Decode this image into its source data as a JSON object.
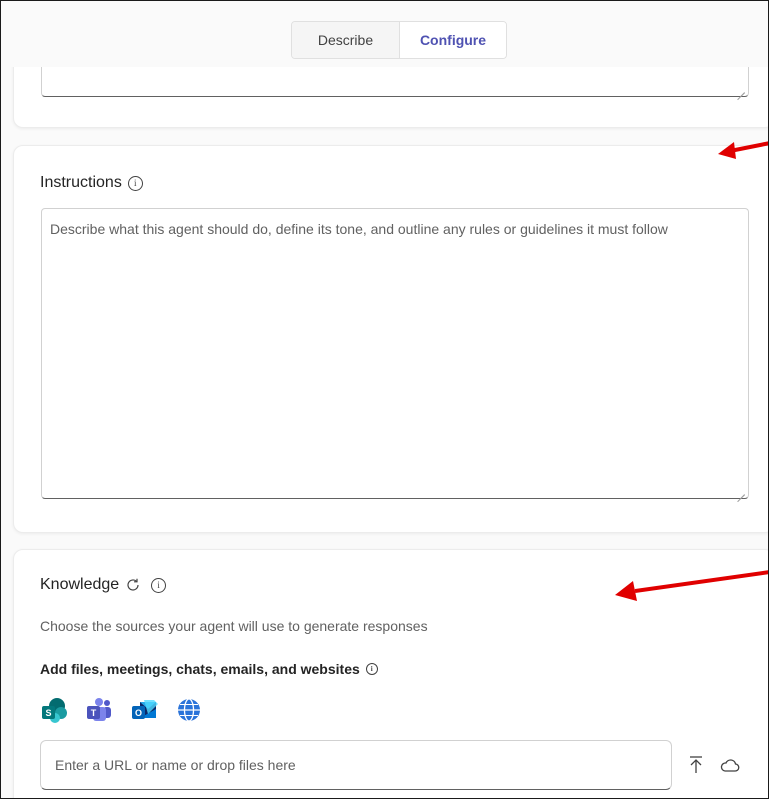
{
  "tabs": {
    "describe": "Describe",
    "configure": "Configure"
  },
  "instructions": {
    "title": "Instructions",
    "placeholder": "Describe what this agent should do, define its tone, and outline any rules or guidelines it must follow"
  },
  "knowledge": {
    "title": "Knowledge",
    "description": "Choose the sources your agent will use to generate responses",
    "add_label": "Add files, meetings, chats, emails, and websites",
    "sources": [
      "sharepoint-icon",
      "teams-icon",
      "outlook-icon",
      "web-icon"
    ],
    "input_placeholder": "Enter a URL or name or drop files here"
  },
  "colors": {
    "accent": "#4f52b2",
    "annotation_arrow": "#e00000"
  }
}
